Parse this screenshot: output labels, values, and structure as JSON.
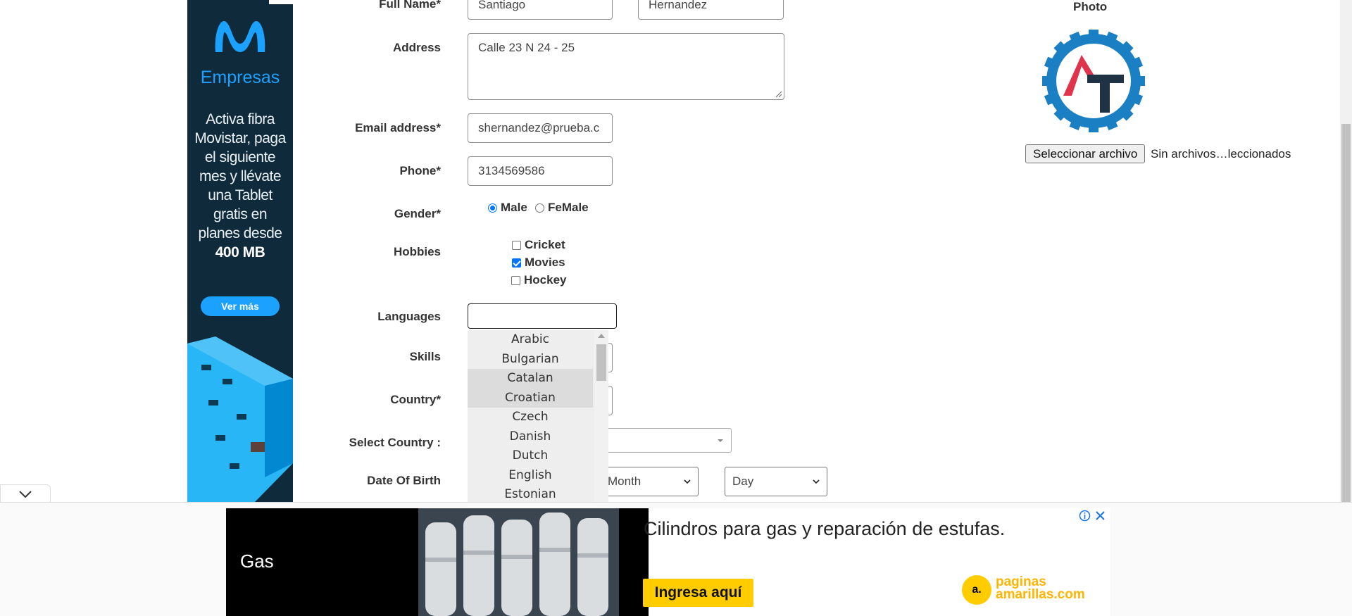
{
  "left_ad": {
    "brand": "Empresas",
    "copy_lines": [
      "Activa fibra",
      "Movistar, paga",
      "el siguiente",
      "mes y llévate",
      "una Tablet",
      "gratis en",
      "planes desde"
    ],
    "highlight": "400 MB",
    "cta": "Ver más",
    "colors": {
      "background": "#0f2a3a",
      "accent": "#1ba1ff"
    }
  },
  "form": {
    "full_name": {
      "label": "Full Name*",
      "first": "Santiago",
      "last": "Hernandez"
    },
    "address": {
      "label": "Address",
      "value": "Calle 23 N 24 - 25"
    },
    "email": {
      "label": "Email address*",
      "value": "shernandez@prueba.c"
    },
    "phone": {
      "label": "Phone*",
      "value": "3134569586"
    },
    "gender": {
      "label": "Gender*",
      "options": [
        "Male",
        "FeMale"
      ],
      "selected": "Male"
    },
    "hobbies": {
      "label": "Hobbies",
      "options": [
        {
          "label": "Cricket",
          "checked": false
        },
        {
          "label": "Movies",
          "checked": true
        },
        {
          "label": "Hockey",
          "checked": false
        }
      ]
    },
    "languages": {
      "label": "Languages",
      "value": ""
    },
    "skills": {
      "label": "Skills"
    },
    "country": {
      "label": "Country*"
    },
    "select_country": {
      "label": "Select Country :",
      "value": ""
    },
    "dob": {
      "label": "Date Of Birth",
      "month": "Month",
      "day": "Day"
    }
  },
  "language_options": [
    {
      "name": "Arabic",
      "highlighted": false
    },
    {
      "name": "Bulgarian",
      "highlighted": false
    },
    {
      "name": "Catalan",
      "highlighted": true
    },
    {
      "name": "Croatian",
      "highlighted": true
    },
    {
      "name": "Czech",
      "highlighted": false
    },
    {
      "name": "Danish",
      "highlighted": false
    },
    {
      "name": "Dutch",
      "highlighted": false
    },
    {
      "name": "English",
      "highlighted": false
    },
    {
      "name": "Estonian",
      "highlighted": false
    }
  ],
  "photo": {
    "title": "Photo",
    "button": "Seleccionar archivo",
    "status": "Sin archivos…leccionados"
  },
  "bottom_ad": {
    "label": "Gas",
    "headline": "Cilindros para gas y reparación de estufas.",
    "cta": "Ingresa aquí",
    "logo_line1": "paginas",
    "logo_line2": "amarillas.com",
    "logo_mark": "a."
  }
}
